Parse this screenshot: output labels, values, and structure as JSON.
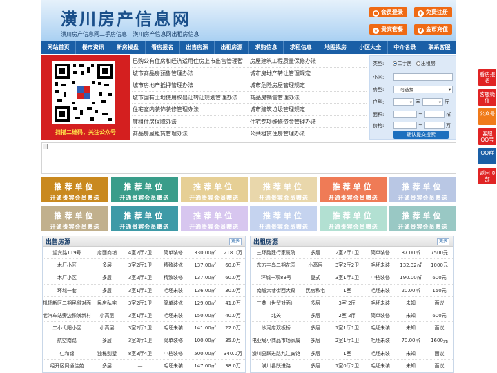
{
  "header": {
    "title": "潢川房产信息网",
    "subtitle": "潢川房产信息网二手房信息 潢川房产信息网出租房信息",
    "buttons": [
      "会员登录",
      "免费注册",
      "贵宾套餐",
      "金币充值"
    ]
  },
  "nav": [
    "网站首页",
    "楼市资讯",
    "新房楼盘",
    "看房报名",
    "出售房源",
    "出租房源",
    "求购信息",
    "求租信息",
    "地图找房",
    "小区大全",
    "中介名录",
    "联系客服"
  ],
  "qr": {
    "caption": "扫描二维码，关注公众号"
  },
  "links": [
    [
      "已购公有住房和经济适用住房上市出售管理暂",
      "房屋建筑工程质量保修办法"
    ],
    [
      "城市商品房预售管理办法",
      "城市房地产转让管理规定"
    ],
    [
      "城市房地产抵押管理办法",
      "城市危险房屋管理规定"
    ],
    [
      "城市国有土地使用权出让转让规划管理办法",
      "商品房销售管理办法"
    ],
    [
      "住宅室内装饰装修管理办法",
      "城市建筑垃圾管理规定"
    ],
    [
      "廉租住房保障办法",
      "住宅专项维修资金管理办法"
    ],
    [
      "商品房屋租赁管理办法",
      "公共租赁住房管理办法"
    ]
  ],
  "search": {
    "type_label": "类型:",
    "type_options": [
      "二手房",
      "出租房"
    ],
    "community_label": "小区:",
    "houseform_label": "房型:",
    "houseform_value": "-- 可选择 --",
    "rooms_label": "户型:",
    "rooms_unit1": "室",
    "rooms_unit2": "厅",
    "area_label": "面积:",
    "area_unit": "㎡",
    "price_label": "价格:",
    "price_unit": "万",
    "range_sep": "~",
    "submit": "确认提交搜索"
  },
  "ads": {
    "line1": "推荐单位",
    "line2": "开通贵宾会员赠送",
    "colors": [
      "#c9891f",
      "#3a9d8a",
      "#e6cf95",
      "#e9d7ab",
      "#ef7b56",
      "#b9c7e4",
      "#c1b08d",
      "#3e9aa7",
      "#d7c6ef",
      "#c5d3ef",
      "#b2e0d2",
      "#99c8c4"
    ]
  },
  "sale": {
    "title": "出售房源",
    "more": "更多",
    "rows": [
      [
        "迎宾路119号",
        "店面商铺",
        "4室2厅2卫",
        "简单装修",
        "330.00㎡",
        "218.0万"
      ],
      [
        "木厂小区",
        "多层",
        "3室2厅1卫",
        "精致装修",
        "137.00㎡",
        "60.0万"
      ],
      [
        "木厂小区",
        "多层",
        "3室2厅1卫",
        "精致装修",
        "137.00㎡",
        "60.0万"
      ],
      [
        "环城一巷",
        "多层",
        "3室1厅1卫",
        "毛坯未装",
        "136.00㎡",
        "30.0万"
      ],
      [
        "机场新区二期民斜对面",
        "民房私宅",
        "3室2厅1卫",
        "简单装修",
        "129.00㎡",
        "41.0万"
      ],
      [
        "老汽车站旁边豫潢新村",
        "小高层",
        "3室1厅1卫",
        "毛坯未装",
        "150.00㎡",
        "40.0万"
      ],
      [
        "二小弋阳小区",
        "小高层",
        "3室2厅1卫",
        "毛坯未装",
        "141.00㎡",
        "22.0万"
      ],
      [
        "航空南路",
        "多层",
        "3室2厅1卫",
        "简单装修",
        "100.00㎡",
        "35.0万"
      ],
      [
        "仁和锦",
        "独栋别墅",
        "8室3厅4卫",
        "中档装修",
        "500.00㎡",
        "340.0万"
      ],
      [
        "经开区网通佳苑",
        "多层",
        "—",
        "毛坯未装",
        "147.00㎡",
        "38.0万"
      ]
    ]
  },
  "rent": {
    "title": "出租房源",
    "more": "更多",
    "rows": [
      [
        "三环路建行家属院",
        "多层",
        "2室2厅1卫",
        "简单装修",
        "87.00㎡",
        "7500元"
      ],
      [
        "东方丰岛二期花园",
        "小高层",
        "3室2厅2卫",
        "毛坯未装",
        "132.32㎡",
        "1000元"
      ],
      [
        "环城一项83号",
        "复式",
        "3室1厅1卫",
        "中档装修",
        "190.00㎡",
        "600元"
      ],
      [
        "南城大巷街西大段",
        "民房私宅",
        "1室",
        "毛坯未装",
        "20.00㎡",
        "150元"
      ],
      [
        "三巷（世贸对面）",
        "多层",
        "3室 2厅",
        "毛坯未装",
        "未知",
        "面议"
      ],
      [
        "北关",
        "多层",
        "2室 2厅",
        "简单装修",
        "未知",
        "600元"
      ],
      [
        "沙河店双板桥",
        "多层",
        "1室1厅1卫",
        "毛坯未装",
        "未知",
        "面议"
      ],
      [
        "电业局小商品市场家属",
        "多层",
        "2室1厅1卫",
        "毛坯未装",
        "70.00㎡",
        "1600元"
      ],
      [
        "潢川县跃进路九江宾馆",
        "多层",
        "1室",
        "毛坯未装",
        "未知",
        "面议"
      ],
      [
        "潢川县跃进路",
        "多层",
        "1室0厅2卫",
        "毛坯未装",
        "未知",
        "面议"
      ]
    ]
  },
  "sidebar": [
    {
      "label": "看房报名",
      "color": "#e02424"
    },
    {
      "label": "客服微信",
      "color": "#e02424"
    },
    {
      "label": "公众号",
      "color": "#f07a1a"
    },
    {
      "label": "客服QQ号",
      "color": "#e02424"
    },
    {
      "label": "QQ群",
      "color": "#1a5fa6"
    },
    {
      "label": "返回顶部",
      "color": "#e02424"
    }
  ]
}
